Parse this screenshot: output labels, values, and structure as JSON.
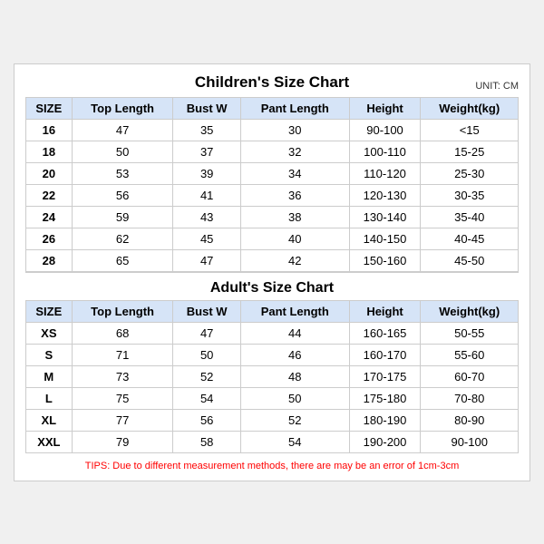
{
  "chart": {
    "title": "Children's Size Chart",
    "unit": "UNIT: CM",
    "adults_title": "Adult's Size Chart",
    "columns": [
      "SIZE",
      "Top Length",
      "Bust W",
      "Pant Length",
      "Height",
      "Weight(kg)"
    ],
    "children_rows": [
      [
        "16",
        "47",
        "35",
        "30",
        "90-100",
        "<15"
      ],
      [
        "18",
        "50",
        "37",
        "32",
        "100-110",
        "15-25"
      ],
      [
        "20",
        "53",
        "39",
        "34",
        "110-120",
        "25-30"
      ],
      [
        "22",
        "56",
        "41",
        "36",
        "120-130",
        "30-35"
      ],
      [
        "24",
        "59",
        "43",
        "38",
        "130-140",
        "35-40"
      ],
      [
        "26",
        "62",
        "45",
        "40",
        "140-150",
        "40-45"
      ],
      [
        "28",
        "65",
        "47",
        "42",
        "150-160",
        "45-50"
      ]
    ],
    "adult_rows": [
      [
        "XS",
        "68",
        "47",
        "44",
        "160-165",
        "50-55"
      ],
      [
        "S",
        "71",
        "50",
        "46",
        "160-170",
        "55-60"
      ],
      [
        "M",
        "73",
        "52",
        "48",
        "170-175",
        "60-70"
      ],
      [
        "L",
        "75",
        "54",
        "50",
        "175-180",
        "70-80"
      ],
      [
        "XL",
        "77",
        "56",
        "52",
        "180-190",
        "80-90"
      ],
      [
        "XXL",
        "79",
        "58",
        "54",
        "190-200",
        "90-100"
      ]
    ],
    "tips": "TIPS: Due to different measurement methods, there are may be an error of 1cm-3cm"
  }
}
